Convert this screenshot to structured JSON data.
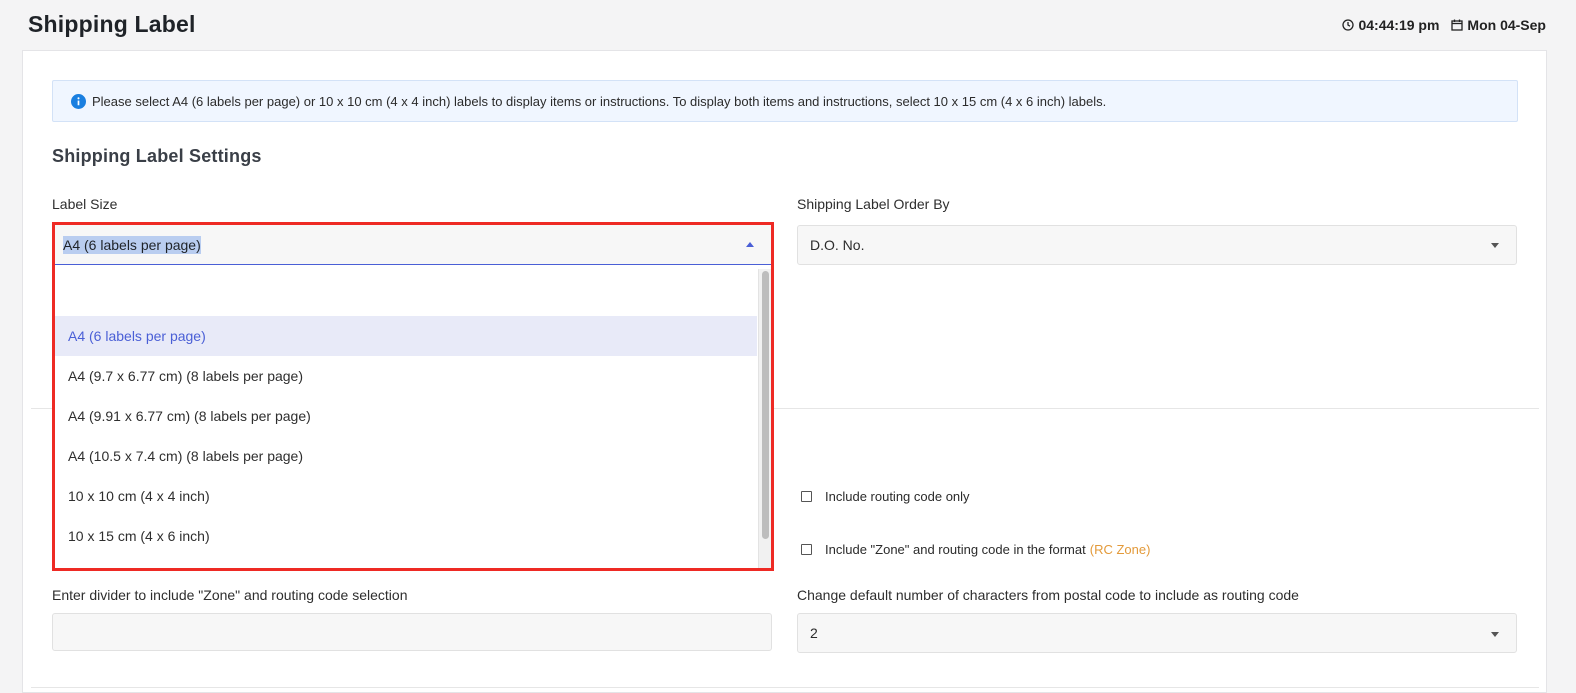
{
  "header": {
    "title": "Shipping Label",
    "time": "04:44:19 pm",
    "date": "Mon 04-Sep"
  },
  "banner": {
    "text": "Please select A4 (6 labels per page) or 10 x 10 cm (4 x 4 inch) labels to display items or instructions. To display both items and instructions, select 10 x 15 cm (4 x 6 inch) labels."
  },
  "settings": {
    "title": "Shipping Label Settings",
    "label_size": {
      "label": "Label Size",
      "selected": "A4 (6 labels per page)",
      "options": [
        "A4 (6 labels per page)",
        "A4 (9.7 x 6.77 cm) (8 labels per page)",
        "A4 (9.91 x 6.77 cm) (8 labels per page)",
        "A4 (10.5 x 7.4 cm) (8 labels per page)",
        "10 x 10 cm (4 x 4 inch)",
        "10 x 15 cm (4 x 6 inch)"
      ]
    },
    "order_by": {
      "label": "Shipping Label Order By",
      "value": "D.O. No."
    }
  },
  "routing": {
    "checkbox_routing_only": "Include routing code only",
    "checkbox_zone_routing": "Include \"Zone\" and routing code in the format",
    "checkbox_zone_routing_hint": "(RC Zone)",
    "divider_label": "Enter divider to include \"Zone\" and routing code selection",
    "divider_value": "",
    "chars_label": "Change default number of characters from postal code to include as routing code",
    "chars_value": "2"
  },
  "colors": {
    "highlight": "#ee2a24",
    "accent": "#4a5fd6",
    "hint": "#e39a3a"
  }
}
